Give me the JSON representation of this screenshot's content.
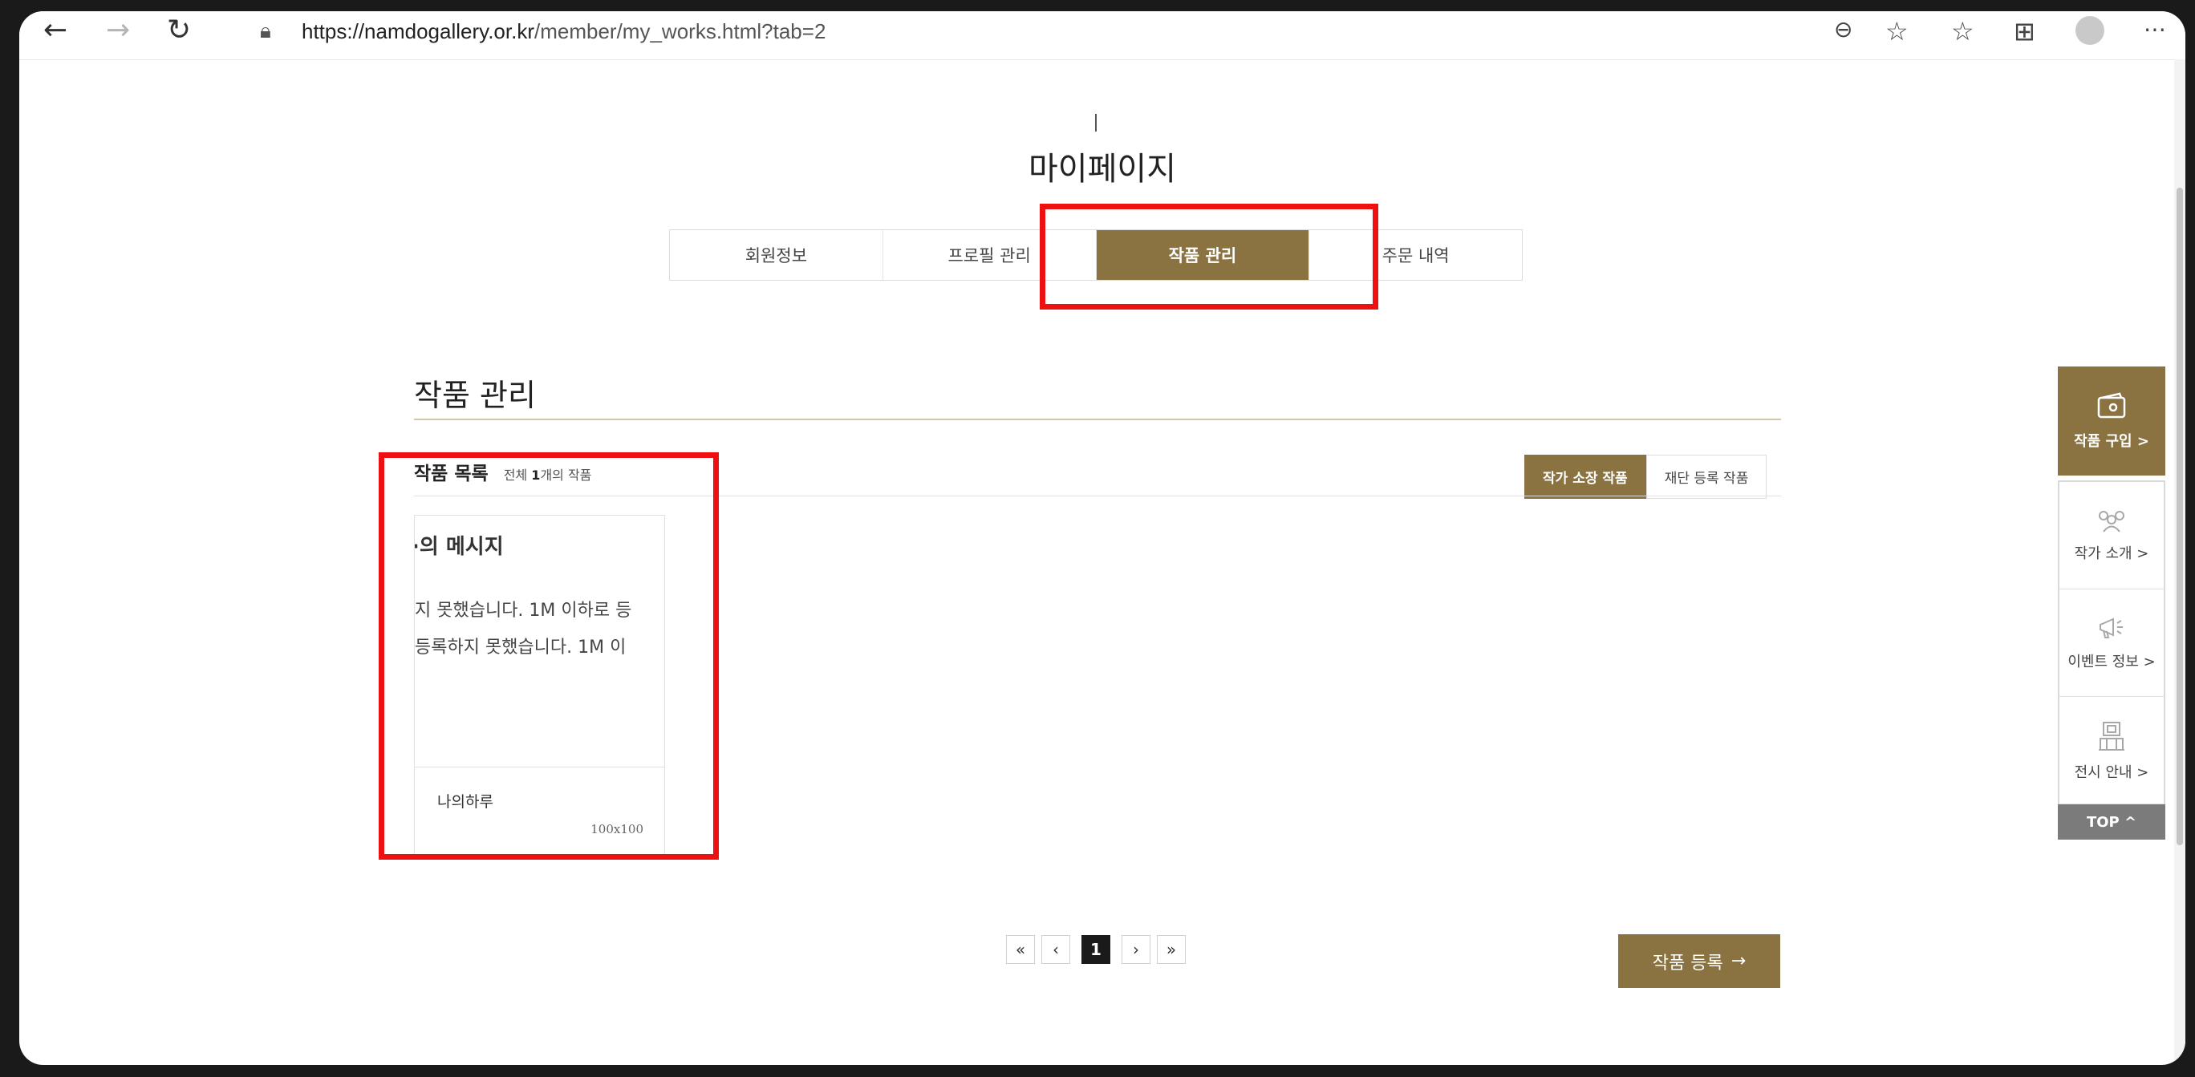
{
  "browser": {
    "url_host": "https://namdogallery.or.kr",
    "url_path": "/member/my_works.html?tab=2"
  },
  "page": {
    "title": "마이페이지",
    "tabs": [
      {
        "label": "회원정보",
        "active": false
      },
      {
        "label": "프로필 관리",
        "active": false
      },
      {
        "label": "작품 관리",
        "active": true
      },
      {
        "label": "주문 내역",
        "active": false
      }
    ]
  },
  "works": {
    "section_title": "작품 관리",
    "list_title": "작품 목록",
    "count_prefix": "전체",
    "count_value": "1",
    "count_suffix": "개의 작품",
    "filters": [
      {
        "label": "작가 소장 작품",
        "active": true
      },
      {
        "label": "재단 등록 작품",
        "active": false
      }
    ],
    "card": {
      "thumb_title": "·의 메시지",
      "thumb_line1": "지 못했습니다. 1M 이하로 등",
      "thumb_line2": " 등록하지 못했습니다. 1M 이",
      "name": "나의하루",
      "size": "100x100"
    },
    "pagination": {
      "first": "«",
      "prev": "‹",
      "current": "1",
      "next": "›",
      "last": "»"
    },
    "register_label": "작품 등록",
    "register_arrow": "→"
  },
  "quick_menu": {
    "buy_label": "작품 구입 >",
    "items": [
      {
        "label": "작가 소개 >",
        "icon": "people-icon"
      },
      {
        "label": "이벤트 정보 >",
        "icon": "megaphone-icon"
      },
      {
        "label": "전시 안내 >",
        "icon": "exhibition-icon"
      }
    ],
    "top_label": "TOP ^"
  },
  "colors": {
    "brand": "#8b7341",
    "highlight": "#ee1111"
  }
}
